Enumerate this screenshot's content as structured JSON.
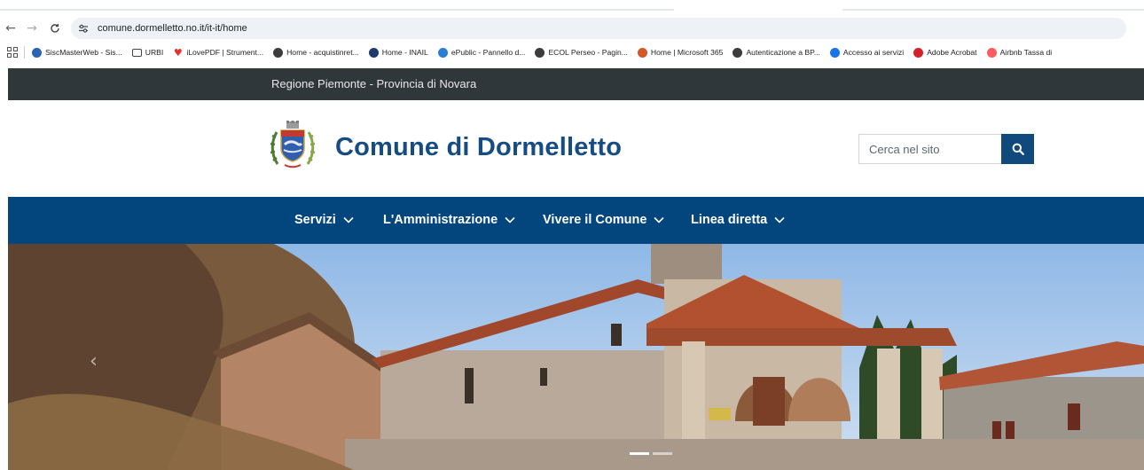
{
  "browser": {
    "url": "comune.dormelletto.no.it/it-it/home",
    "bookmarks": [
      {
        "label": "SiscMasterWeb - Sis...",
        "icon": "siscmaster-icon",
        "color": "#2a62b4"
      },
      {
        "label": "URBI",
        "icon": "folder-icon",
        "color": "#ffffff"
      },
      {
        "label": "iLovePDF | Strument...",
        "icon": "ilovepdf-heart-icon",
        "color": "#e5322d"
      },
      {
        "label": "Home - acquistinret...",
        "icon": "globe-icon",
        "color": "#3c3c3c"
      },
      {
        "label": "Home - INAIL",
        "icon": "inail-icon",
        "color": "#1f3b6e"
      },
      {
        "label": "ePublic - Pannello d...",
        "icon": "epublic-icon",
        "color": "#2a7fd4"
      },
      {
        "label": "ECOL Perseo - Pagin...",
        "icon": "globe-icon",
        "color": "#3c3c3c"
      },
      {
        "label": "Home | Microsoft 365",
        "icon": "microsoft365-icon",
        "color": "#d4572a"
      },
      {
        "label": "Autenticazione a BP...",
        "icon": "globe-icon",
        "color": "#3c3c3c"
      },
      {
        "label": "Accesso ai servizi",
        "icon": "accesso-icon",
        "color": "#1a73e8"
      },
      {
        "label": "Adobe Acrobat",
        "icon": "adobe-acrobat-icon",
        "color": "#d4202a"
      },
      {
        "label": "Airbnb Tassa di",
        "icon": "airbnb-icon",
        "color": "#ff5a5f"
      }
    ]
  },
  "site": {
    "region": "Regione Piemonte - Provincia di Novara",
    "title": "Comune di Dormelletto",
    "search_placeholder": "Cerca nel sito",
    "nav": [
      "Servizi",
      "L'Amministrazione",
      "Vivere il Comune",
      "Linea diretta"
    ],
    "carousel": {
      "slides": 2,
      "active": 0
    }
  },
  "colors": {
    "topbar": "#30373b",
    "brand": "#154c84",
    "nav": "#03467d"
  }
}
